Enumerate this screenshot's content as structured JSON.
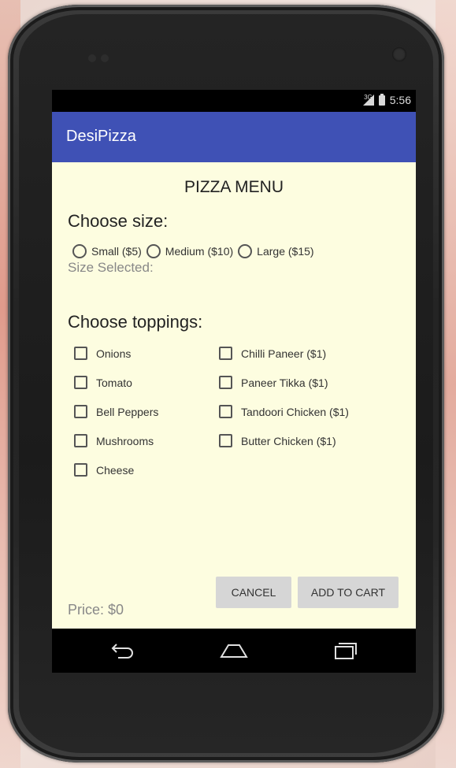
{
  "status_bar": {
    "network_label": "3G",
    "time": "5:56"
  },
  "app_bar": {
    "title": "DesiPizza"
  },
  "menu": {
    "title": "PIZZA MENU",
    "size_section_title": "Choose size:",
    "sizes": [
      {
        "label": "Small ($5)",
        "selected": false
      },
      {
        "label": "Medium ($10)",
        "selected": false
      },
      {
        "label": "Large ($15)",
        "selected": false
      }
    ],
    "size_selected_label": "Size Selected:",
    "toppings_section_title": "Choose toppings:",
    "toppings_left": [
      {
        "label": "Onions",
        "checked": false
      },
      {
        "label": "Tomato",
        "checked": false
      },
      {
        "label": "Bell Peppers",
        "checked": false
      },
      {
        "label": "Mushrooms",
        "checked": false
      },
      {
        "label": "Cheese",
        "checked": false
      }
    ],
    "toppings_right": [
      {
        "label": "Chilli Paneer ($1)",
        "checked": false
      },
      {
        "label": "Paneer Tikka ($1)",
        "checked": false
      },
      {
        "label": "Tandoori Chicken ($1)",
        "checked": false
      },
      {
        "label": "Butter Chicken ($1)",
        "checked": false
      }
    ]
  },
  "footer": {
    "price_label": "Price: $0",
    "cancel_label": "CANCEL",
    "add_to_cart_label": "ADD TO CART"
  },
  "nav": {
    "back_icon": "back-icon",
    "home_icon": "home-icon",
    "recents_icon": "recents-icon"
  },
  "colors": {
    "app_bar": "#3f51b5",
    "screen_background": "#fdfde0",
    "button": "#d6d6d6"
  }
}
